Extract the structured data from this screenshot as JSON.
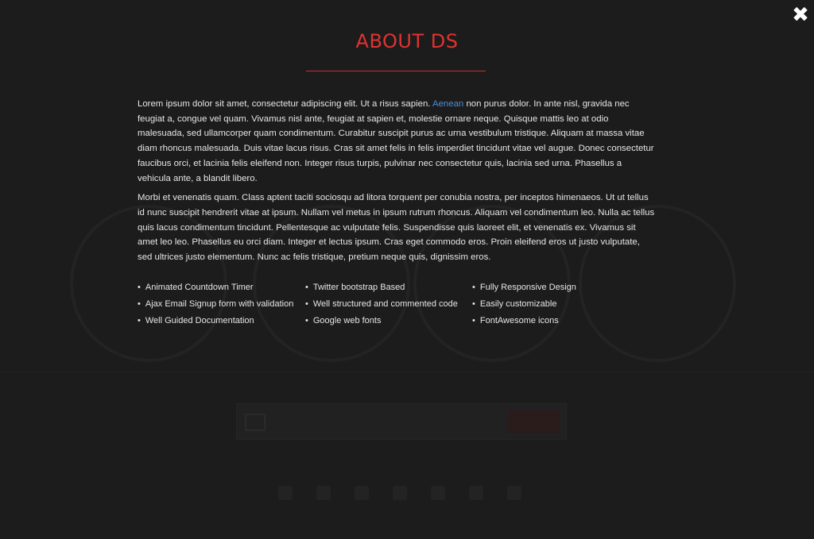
{
  "modal": {
    "title": "ABOUT DS",
    "close_icon": "close-icon",
    "paragraph1_before_link": "Lorem ipsum dolor sit amet, consectetur adipiscing elit. Ut a risus sapien. ",
    "paragraph1_link": "Aenean",
    "paragraph1_after_link": " non purus dolor. In ante nisl, gravida nec feugiat a, congue vel quam. Vivamus nisl ante, feugiat at sapien et, molestie ornare neque. Quisque mattis leo at odio malesuada, sed ullamcorper quam condimentum. Curabitur suscipit purus ac urna vestibulum tristique. Aliquam at massa vitae diam rhoncus malesuada. Duis vitae lacus risus. Cras sit amet felis in felis imperdiet tincidunt vitae vel augue. Donec consectetur faucibus orci, et lacinia felis eleifend non. Integer risus turpis, pulvinar nec consectetur quis, lacinia sed urna. Phasellus a vehicula ante, a blandit libero.",
    "paragraph2": "Morbi et venenatis quam. Class aptent taciti sociosqu ad litora torquent per conubia nostra, per inceptos himenaeos. Ut ut tellus id nunc suscipit hendrerit vitae at ipsum. Nullam vel metus in ipsum rutrum rhoncus. Aliquam vel condimentum leo. Nulla ac tellus quis lacus condimentum tincidunt. Pellentesque ac vulputate felis. Suspendisse quis laoreet elit, et venenatis ex. Vivamus sit amet leo leo. Phasellus eu orci diam. Integer et lectus ipsum. Cras eget commodo eros. Proin eleifend eros ut justo vulputate, sed ultrices justo elementum. Nunc ac felis tristique, pretium neque quis, dignissim eros.",
    "features": [
      "Animated Countdown Timer",
      "Twitter bootstrap Based",
      "Fully Responsive Design",
      "Ajax Email Signup form with validation",
      "Well structured and commented code",
      "Easily customizable",
      "Well Guided Documentation",
      "Google web fonts",
      "FontAwesome icons"
    ]
  },
  "colors": {
    "accent": "#e0332f",
    "link": "#4a90d9",
    "background": "#1c1c1d"
  }
}
